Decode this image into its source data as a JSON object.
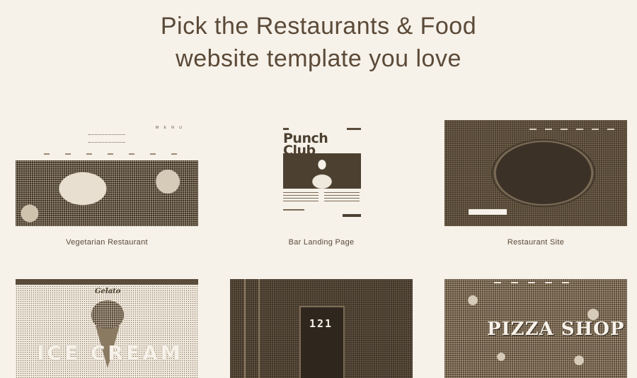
{
  "header": {
    "line1": "Pick the Restaurants & Food",
    "line2": "website template you love"
  },
  "templates": [
    {
      "caption": "Vegetarian Restaurant",
      "preview": {
        "menu_label": "M E N U"
      }
    },
    {
      "caption": "Bar Landing Page",
      "preview": {
        "title_line1": "Punch",
        "title_line2": "Club"
      }
    },
    {
      "caption": "Restaurant Site",
      "preview": {}
    },
    {
      "caption": "",
      "preview": {
        "logo": "Gelato",
        "headline": "ICE CREAM"
      }
    },
    {
      "caption": "",
      "preview": {
        "door_number": "121"
      }
    },
    {
      "caption": "",
      "preview": {
        "headline": "PIZZA SHOP"
      }
    }
  ],
  "colors": {
    "background": "#f6f1e9",
    "text": "#5a4b3a",
    "ink_dark": "#4c4030"
  }
}
